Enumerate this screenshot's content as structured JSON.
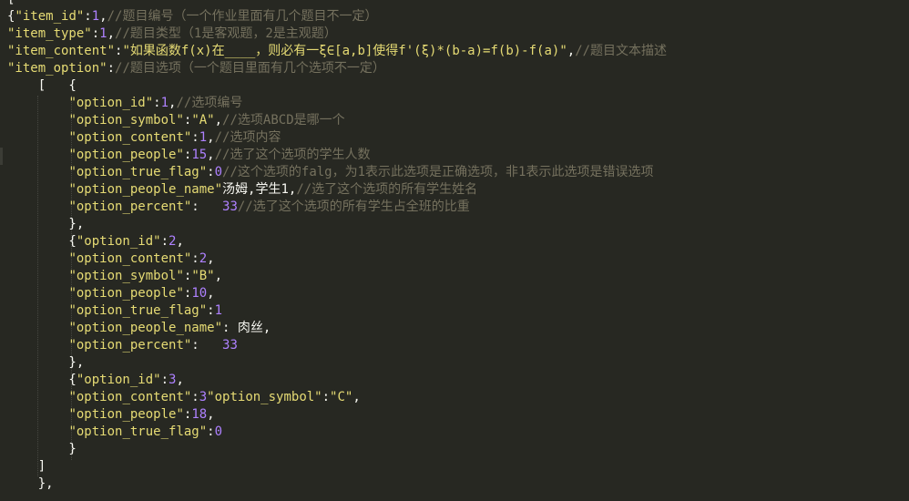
{
  "editor": {
    "theme_colors": {
      "background": "#272822",
      "string": "#E6DB74",
      "number": "#AE81FF",
      "comment": "#75715E",
      "punctuation": "#F8F8F2"
    },
    "lines": [
      [
        {
          "t": "pun",
          "v": "["
        }
      ],
      [
        {
          "t": "pun",
          "v": "{"
        },
        {
          "t": "key",
          "v": "\"item_id\""
        },
        {
          "t": "pun",
          "v": ":"
        },
        {
          "t": "num",
          "v": "1"
        },
        {
          "t": "pun",
          "v": ","
        },
        {
          "t": "cmt",
          "v": "//题目编号（一个作业里面有几个题目不一定）"
        }
      ],
      [
        {
          "t": "key",
          "v": "\"item_type\""
        },
        {
          "t": "pun",
          "v": ":"
        },
        {
          "t": "num",
          "v": "1"
        },
        {
          "t": "pun",
          "v": ","
        },
        {
          "t": "cmt",
          "v": "//题目类型（1是客观题，2是主观题）"
        }
      ],
      [
        {
          "t": "key",
          "v": "\"item_content\""
        },
        {
          "t": "pun",
          "v": ":"
        },
        {
          "t": "str",
          "v": "\"如果函数f(x)在____，则必有一ξ∈[a,b]使得f'(ξ)*(b-a)=f(b)-f(a)\""
        },
        {
          "t": "pun",
          "v": ","
        },
        {
          "t": "cmt",
          "v": "//题目文本描述"
        }
      ],
      [
        {
          "t": "key",
          "v": "\"item_option\""
        },
        {
          "t": "pun",
          "v": ":"
        },
        {
          "t": "cmt",
          "v": "//题目选项（一个题目里面有几个选项不一定）"
        }
      ],
      [
        {
          "t": "pun",
          "v": "    [   {"
        }
      ],
      [
        {
          "t": "pun",
          "v": "        "
        },
        {
          "t": "key",
          "v": "\"option_id\""
        },
        {
          "t": "pun",
          "v": ":"
        },
        {
          "t": "num",
          "v": "1"
        },
        {
          "t": "pun",
          "v": ","
        },
        {
          "t": "cmt",
          "v": "//选项编号"
        }
      ],
      [
        {
          "t": "pun",
          "v": "        "
        },
        {
          "t": "key",
          "v": "\"option_symbol\""
        },
        {
          "t": "pun",
          "v": ":"
        },
        {
          "t": "str",
          "v": "\"A\""
        },
        {
          "t": "pun",
          "v": ","
        },
        {
          "t": "cmt",
          "v": "//选项ABCD是哪一个"
        }
      ],
      [
        {
          "t": "pun",
          "v": "        "
        },
        {
          "t": "key",
          "v": "\"option_content\""
        },
        {
          "t": "pun",
          "v": ":"
        },
        {
          "t": "num",
          "v": "1"
        },
        {
          "t": "pun",
          "v": ","
        },
        {
          "t": "cmt",
          "v": "//选项内容"
        }
      ],
      [
        {
          "t": "pun",
          "v": "        "
        },
        {
          "t": "key",
          "v": "\"option_people\""
        },
        {
          "t": "pun",
          "v": ":"
        },
        {
          "t": "num",
          "v": "15"
        },
        {
          "t": "pun",
          "v": ","
        },
        {
          "t": "cmt",
          "v": "//选了这个选项的学生人数"
        }
      ],
      [
        {
          "t": "pun",
          "v": "        "
        },
        {
          "t": "key",
          "v": "\"option_true_flag\""
        },
        {
          "t": "pun",
          "v": ":"
        },
        {
          "t": "num",
          "v": "0"
        },
        {
          "t": "cmt",
          "v": "//这个选项的falg，为1表示此选项是正确选项，非1表示此选项是错误选项"
        }
      ],
      [
        {
          "t": "pun",
          "v": "        "
        },
        {
          "t": "key",
          "v": "\"option_people_name\""
        },
        {
          "t": "pun",
          "v": "汤姆,学生1,"
        },
        {
          "t": "cmt",
          "v": "//选了这个选项的所有学生姓名"
        }
      ],
      [
        {
          "t": "pun",
          "v": "        "
        },
        {
          "t": "key",
          "v": "\"option_percent\""
        },
        {
          "t": "pun",
          "v": ":   "
        },
        {
          "t": "num",
          "v": "33"
        },
        {
          "t": "cmt",
          "v": "//选了这个选项的所有学生占全班的比重"
        }
      ],
      [
        {
          "t": "pun",
          "v": "        },"
        }
      ],
      [
        {
          "t": "pun",
          "v": "        {"
        },
        {
          "t": "key",
          "v": "\"option_id\""
        },
        {
          "t": "pun",
          "v": ":"
        },
        {
          "t": "num",
          "v": "2"
        },
        {
          "t": "pun",
          "v": ","
        }
      ],
      [
        {
          "t": "pun",
          "v": "        "
        },
        {
          "t": "key",
          "v": "\"option_content\""
        },
        {
          "t": "pun",
          "v": ":"
        },
        {
          "t": "num",
          "v": "2"
        },
        {
          "t": "pun",
          "v": ","
        }
      ],
      [
        {
          "t": "pun",
          "v": "        "
        },
        {
          "t": "key",
          "v": "\"option_symbol\""
        },
        {
          "t": "pun",
          "v": ":"
        },
        {
          "t": "str",
          "v": "\"B\""
        },
        {
          "t": "pun",
          "v": ","
        }
      ],
      [
        {
          "t": "pun",
          "v": "        "
        },
        {
          "t": "key",
          "v": "\"option_people\""
        },
        {
          "t": "pun",
          "v": ":"
        },
        {
          "t": "num",
          "v": "10"
        },
        {
          "t": "pun",
          "v": ","
        }
      ],
      [
        {
          "t": "pun",
          "v": "        "
        },
        {
          "t": "key",
          "v": "\"option_true_flag\""
        },
        {
          "t": "pun",
          "v": ":"
        },
        {
          "t": "num",
          "v": "1"
        }
      ],
      [
        {
          "t": "pun",
          "v": "        "
        },
        {
          "t": "key",
          "v": "\"option_people_name\""
        },
        {
          "t": "pun",
          "v": ": 肉丝,"
        }
      ],
      [
        {
          "t": "pun",
          "v": "        "
        },
        {
          "t": "key",
          "v": "\"option_percent\""
        },
        {
          "t": "pun",
          "v": ":   "
        },
        {
          "t": "num",
          "v": "33"
        }
      ],
      [
        {
          "t": "pun",
          "v": "        },"
        }
      ],
      [
        {
          "t": "pun",
          "v": "        {"
        },
        {
          "t": "key",
          "v": "\"option_id\""
        },
        {
          "t": "pun",
          "v": ":"
        },
        {
          "t": "num",
          "v": "3"
        },
        {
          "t": "pun",
          "v": ","
        }
      ],
      [
        {
          "t": "pun",
          "v": "        "
        },
        {
          "t": "key",
          "v": "\"option_content\""
        },
        {
          "t": "pun",
          "v": ":"
        },
        {
          "t": "num",
          "v": "3"
        },
        {
          "t": "key",
          "v": "\"option_symbol\""
        },
        {
          "t": "pun",
          "v": ":"
        },
        {
          "t": "str",
          "v": "\"C\""
        },
        {
          "t": "pun",
          "v": ","
        }
      ],
      [
        {
          "t": "pun",
          "v": "        "
        },
        {
          "t": "key",
          "v": "\"option_people\""
        },
        {
          "t": "pun",
          "v": ":"
        },
        {
          "t": "num",
          "v": "18"
        },
        {
          "t": "pun",
          "v": ","
        }
      ],
      [
        {
          "t": "pun",
          "v": "        "
        },
        {
          "t": "key",
          "v": "\"option_true_flag\""
        },
        {
          "t": "pun",
          "v": ":"
        },
        {
          "t": "num",
          "v": "0"
        }
      ],
      [
        {
          "t": "pun",
          "v": "        }"
        }
      ],
      [
        {
          "t": "pun",
          "v": "    ]"
        }
      ],
      [
        {
          "t": "pun",
          "v": "    },"
        }
      ]
    ]
  }
}
